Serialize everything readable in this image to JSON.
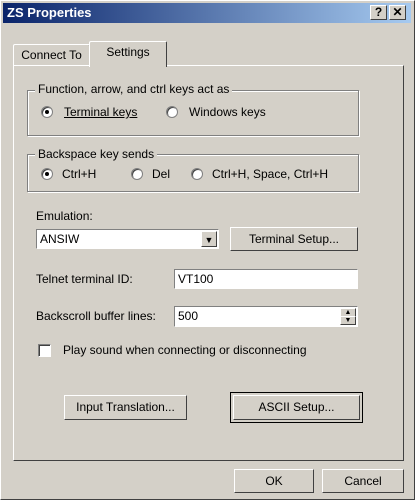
{
  "window": {
    "title": "ZS Properties",
    "help_btn": "?",
    "close_btn": "✕"
  },
  "tabs": [
    {
      "label": "Connect To"
    },
    {
      "label": "Settings"
    }
  ],
  "function_keys": {
    "legend": "Function, arrow, and ctrl keys act as",
    "options": [
      {
        "label": "Terminal keys",
        "selected": true
      },
      {
        "label": "Windows keys",
        "selected": false
      }
    ]
  },
  "backspace": {
    "legend": "Backspace key sends",
    "options": [
      {
        "label": "Ctrl+H",
        "selected": true
      },
      {
        "label": "Del",
        "selected": false
      },
      {
        "label": "Ctrl+H, Space, Ctrl+H",
        "selected": false
      }
    ]
  },
  "emulation": {
    "label": "Emulation:",
    "value": "ANSIW",
    "setup_button": "Terminal Setup..."
  },
  "telnet_id": {
    "label": "Telnet terminal ID:",
    "value": "VT100"
  },
  "backscroll": {
    "label": "Backscroll buffer lines:",
    "value": "500"
  },
  "play_sound": {
    "label": "Play sound when connecting or disconnecting",
    "checked": false
  },
  "buttons": {
    "input_translation": "Input Translation...",
    "ascii_setup": "ASCII Setup...",
    "ok": "OK",
    "cancel": "Cancel"
  }
}
